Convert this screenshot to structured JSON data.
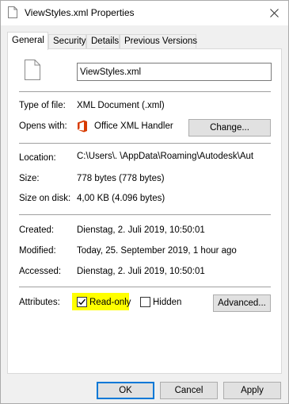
{
  "window": {
    "title": "ViewStyles.xml Properties"
  },
  "tabs": [
    {
      "label": "General",
      "active": true
    },
    {
      "label": "Security",
      "active": false
    },
    {
      "label": "Details",
      "active": false
    },
    {
      "label": "Previous Versions",
      "active": false
    }
  ],
  "general": {
    "filename": "ViewStyles.xml",
    "type_label": "Type of file:",
    "type_value": "XML Document (.xml)",
    "opens_label": "Opens with:",
    "opens_value": "Office XML Handler",
    "change_button": "Change...",
    "location_label": "Location:",
    "location_value": "C:\\Users\\.            \\AppData\\Roaming\\Autodesk\\Aut",
    "size_label": "Size:",
    "size_value": "778 bytes (778 bytes)",
    "size_on_disk_label": "Size on disk:",
    "size_on_disk_value": "4,00 KB (4.096 bytes)",
    "created_label": "Created:",
    "created_value": "Dienstag, 2. Juli 2019, 10:50:01",
    "modified_label": "Modified:",
    "modified_value": "Today, 25. September 2019, 1 hour ago",
    "accessed_label": "Accessed:",
    "accessed_value": "Dienstag, 2. Juli 2019, 10:50:01",
    "attributes_label": "Attributes:",
    "readonly_label": "Read-only",
    "readonly_checked": true,
    "hidden_label": "Hidden",
    "hidden_checked": false,
    "advanced_button": "Advanced..."
  },
  "footer": {
    "ok": "OK",
    "cancel": "Cancel",
    "apply": "Apply"
  },
  "colors": {
    "highlight": "#ffff00",
    "office_icon": "#d83b01",
    "default_button_border": "#0078d7"
  }
}
